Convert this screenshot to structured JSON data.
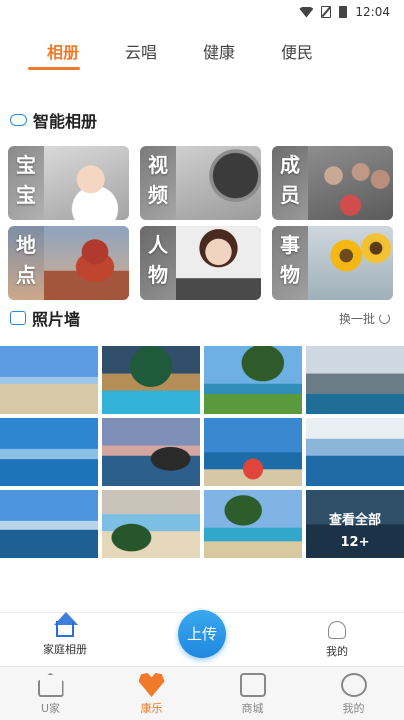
{
  "status_bar": {
    "time": "12:04"
  },
  "top_tabs": [
    "相册",
    "云唱",
    "健康",
    "便民"
  ],
  "smart_album": {
    "title": "智能相册",
    "tiles": [
      {
        "label": "宝宝",
        "icon": "baby-photo"
      },
      {
        "label": "视频",
        "icon": "video-photo"
      },
      {
        "label": "成员",
        "icon": "family-photo"
      },
      {
        "label": "地点",
        "icon": "place-photo"
      },
      {
        "label": "人物",
        "icon": "person-photo"
      },
      {
        "label": "事物",
        "icon": "thing-photo"
      }
    ]
  },
  "photo_wall": {
    "title": "照片墙",
    "refresh_label": "换一批",
    "more_label": "查看全部",
    "more_count": "12+"
  },
  "inner_nav": {
    "home_label": "家庭相册",
    "upload_label": "上传",
    "mine_label": "我的"
  },
  "bottom_nav": [
    {
      "label": "U家",
      "icon": "house-icon"
    },
    {
      "label": "康乐",
      "icon": "heart-icon"
    },
    {
      "label": "商城",
      "icon": "shop-icon"
    },
    {
      "label": "我的",
      "icon": "smile-icon"
    }
  ],
  "colors": {
    "accent": "#f07a2a",
    "primary_blue": "#1f88de"
  }
}
